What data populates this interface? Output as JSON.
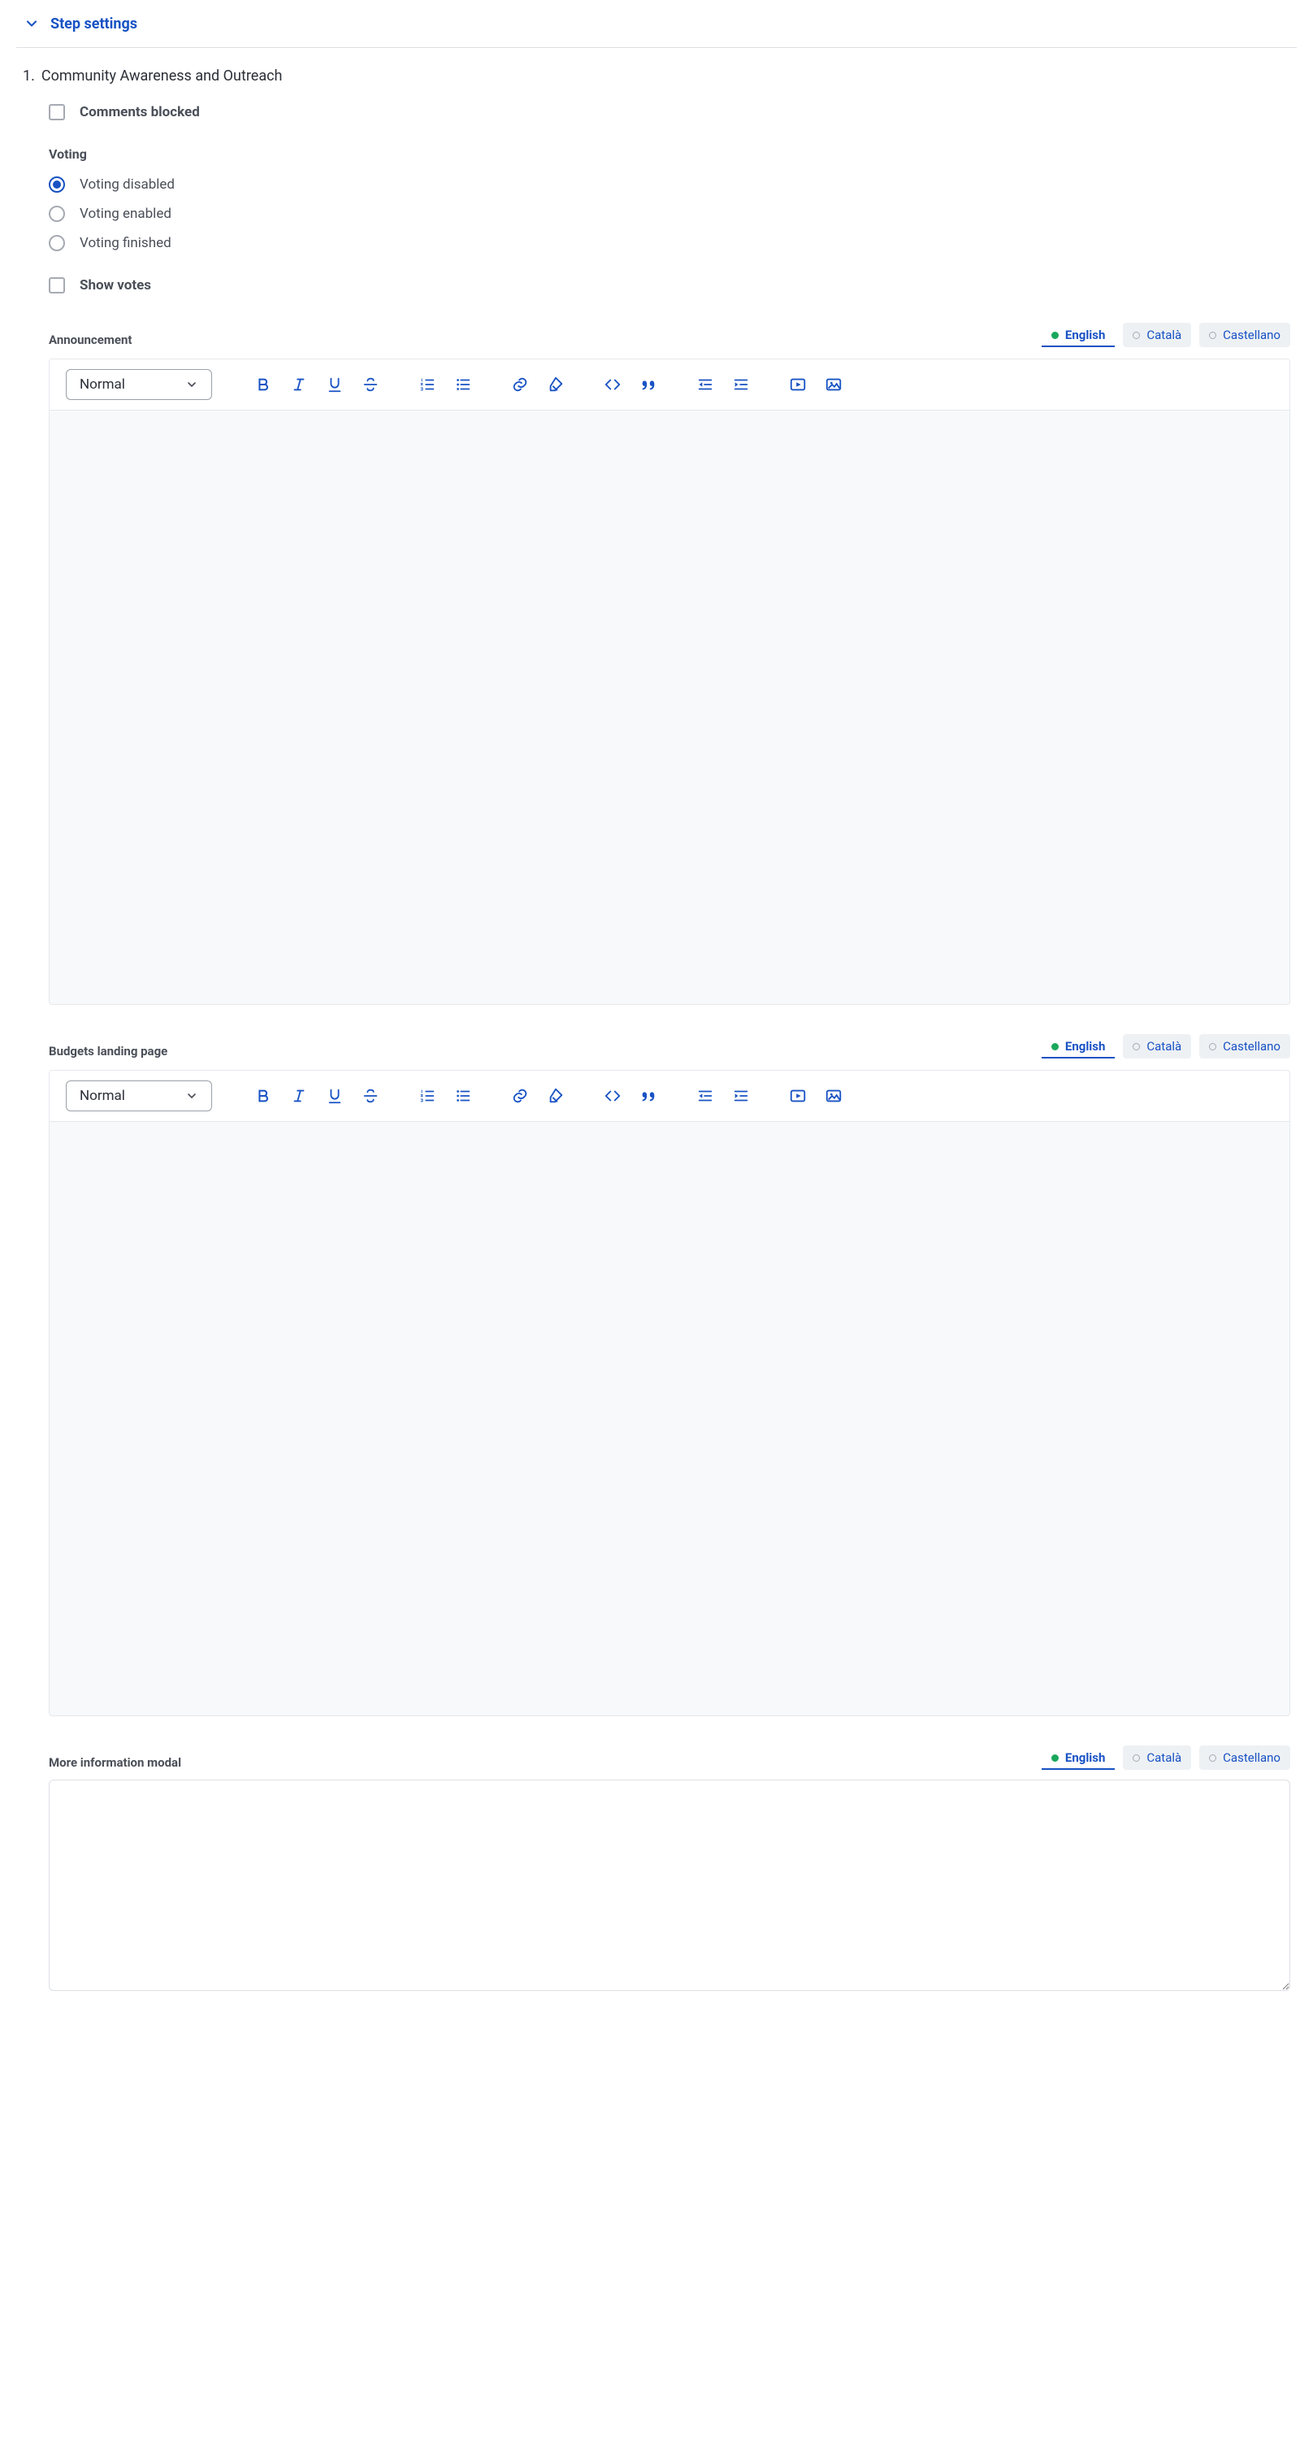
{
  "accordion": {
    "title": "Step settings"
  },
  "step": {
    "ordinal": "1.",
    "name": "Community Awareness and Outreach"
  },
  "checkboxes": {
    "comments_blocked": {
      "label": "Comments blocked",
      "checked": false
    },
    "show_votes": {
      "label": "Show votes",
      "checked": false
    }
  },
  "voting": {
    "section_label": "Voting",
    "options": [
      {
        "label": "Voting disabled",
        "selected": true
      },
      {
        "label": "Voting enabled",
        "selected": false
      },
      {
        "label": "Voting finished",
        "selected": false
      }
    ]
  },
  "lang_tabs": [
    {
      "label": "English",
      "active": true,
      "status": "filled"
    },
    {
      "label": "Català",
      "active": false,
      "status": "empty"
    },
    {
      "label": "Castellano",
      "active": false,
      "status": "empty"
    }
  ],
  "rte": {
    "format_select": "Normal",
    "icons": {
      "bold": "bold-icon",
      "italic": "italic-icon",
      "underline": "underline-icon",
      "strike": "strike-icon",
      "ol": "ordered-list-icon",
      "ul": "unordered-list-icon",
      "link": "link-icon",
      "clean": "clean-icon",
      "code": "code-icon",
      "quote": "blockquote-icon",
      "outdent": "outdent-icon",
      "indent": "indent-icon",
      "video": "video-icon",
      "image": "image-icon"
    }
  },
  "fields": {
    "announcement": {
      "title": "Announcement",
      "value": ""
    },
    "budgets_landing": {
      "title": "Budgets landing page",
      "value": ""
    },
    "more_info": {
      "title": "More information modal",
      "value": ""
    }
  }
}
